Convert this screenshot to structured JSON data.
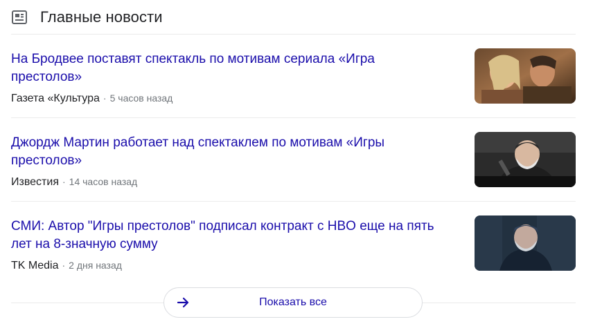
{
  "header": {
    "title": "Главные новости",
    "icon": "newspaper-icon"
  },
  "articles": [
    {
      "headline": "На Бродвее поставят спектакль по мотивам сериала «Игра престолов»",
      "source": "Газета «Культура",
      "separator": "·",
      "time": "5 часов назад",
      "thumbnail": "photo-couple"
    },
    {
      "headline": "Джордж Мартин работает над спектаклем по мотивам «Игры престолов»",
      "source": "Известия",
      "separator": "·",
      "time": "14 часов назад",
      "thumbnail": "photo-speaker"
    },
    {
      "headline": "СМИ: Автор \"Игры престолов\" подписал контракт с HBO еще на пять лет на 8-значную сумму",
      "source": "TK Media",
      "separator": "·",
      "time": "2 дня назад",
      "thumbnail": "photo-author-hbo"
    }
  ],
  "footer": {
    "show_all_label": "Показать все",
    "icon": "arrow-right-icon"
  },
  "colors": {
    "link": "#1a0dab",
    "muted": "#70757a",
    "divider": "#ebebeb"
  }
}
